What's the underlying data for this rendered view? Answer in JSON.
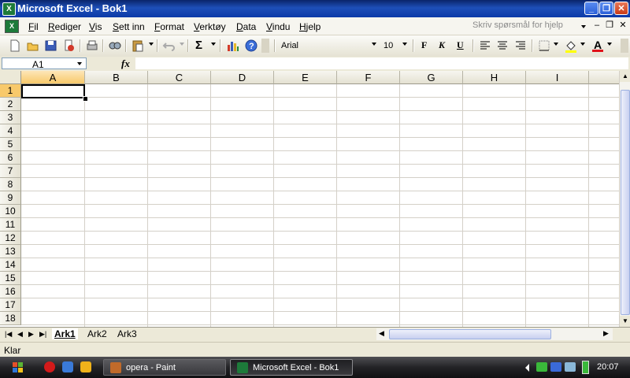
{
  "window": {
    "title": "Microsoft Excel - Bok1",
    "app_icon": "excel-icon"
  },
  "menu": {
    "items": [
      "Fil",
      "Rediger",
      "Vis",
      "Sett inn",
      "Format",
      "Verktøy",
      "Data",
      "Vindu",
      "Hjelp"
    ],
    "help_placeholder": "Skriv spørsmål for hjelp"
  },
  "toolbar": {
    "font_name": "Arial",
    "font_size": "10",
    "bold_label": "F",
    "italic_label": "K",
    "underline_label": "U",
    "sum_symbol": "Σ"
  },
  "formula_bar": {
    "name_box": "A1",
    "fx_label": "fx",
    "value": ""
  },
  "sheet": {
    "columns": [
      "A",
      "B",
      "C",
      "D",
      "E",
      "F",
      "G",
      "H",
      "I"
    ],
    "rows": [
      "1",
      "2",
      "3",
      "4",
      "5",
      "6",
      "7",
      "8",
      "9",
      "10",
      "11",
      "12",
      "13",
      "14",
      "15",
      "16",
      "17",
      "18"
    ],
    "active_cell": "A1"
  },
  "tabs": [
    "Ark1",
    "Ark2",
    "Ark3"
  ],
  "status": {
    "text": "Klar"
  },
  "taskbar": {
    "tasks": [
      {
        "label": "opera - Paint",
        "active": false
      },
      {
        "label": "Microsoft Excel - Bok1",
        "active": true
      }
    ],
    "clock": "20:07"
  },
  "colors": {
    "title_bar": "#0a246a",
    "selection_header": "#f8c96a",
    "taskbar": "#232326",
    "excel_green": "#1d7a3a"
  }
}
